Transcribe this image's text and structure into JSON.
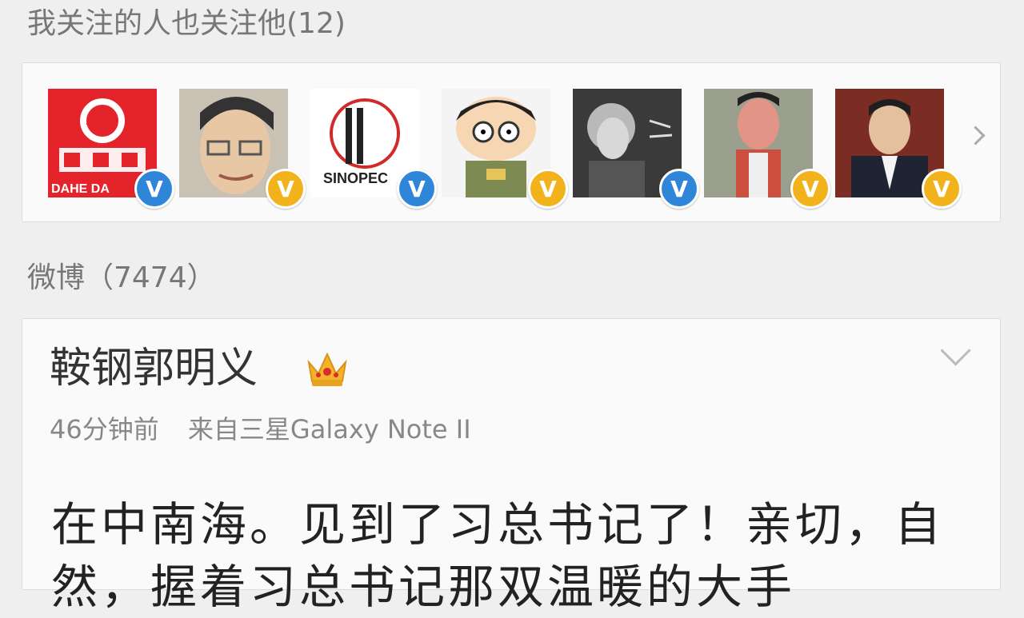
{
  "follow_section": {
    "title": "我关注的人也关注他(12)",
    "users": [
      {
        "badge": "V",
        "badge_color": "#2f86d8",
        "logo_text": "DAHE DA"
      },
      {
        "badge": "V",
        "badge_color": "#f1b21c"
      },
      {
        "badge": "V",
        "badge_color": "#2f86d8",
        "logo_text": "SINOPEC"
      },
      {
        "badge": "V",
        "badge_color": "#f1b21c"
      },
      {
        "badge": "V",
        "badge_color": "#2f86d8"
      },
      {
        "badge": "V",
        "badge_color": "#f1b21c"
      },
      {
        "badge": "V",
        "badge_color": "#f1b21c"
      }
    ]
  },
  "weibo_section": {
    "title": "微博（7474）"
  },
  "post": {
    "author": "鞍钢郭明义",
    "time": "46分钟前",
    "source": "来自三星Galaxy Note II",
    "text": "在中南海。见到了习总书记了！亲切，自然，握着习总书记那双温暖的大手"
  },
  "colors": {
    "background": "#efefef",
    "card": "#fafafa",
    "verified_blue": "#2f86d8",
    "verified_gold": "#f1b21c"
  }
}
